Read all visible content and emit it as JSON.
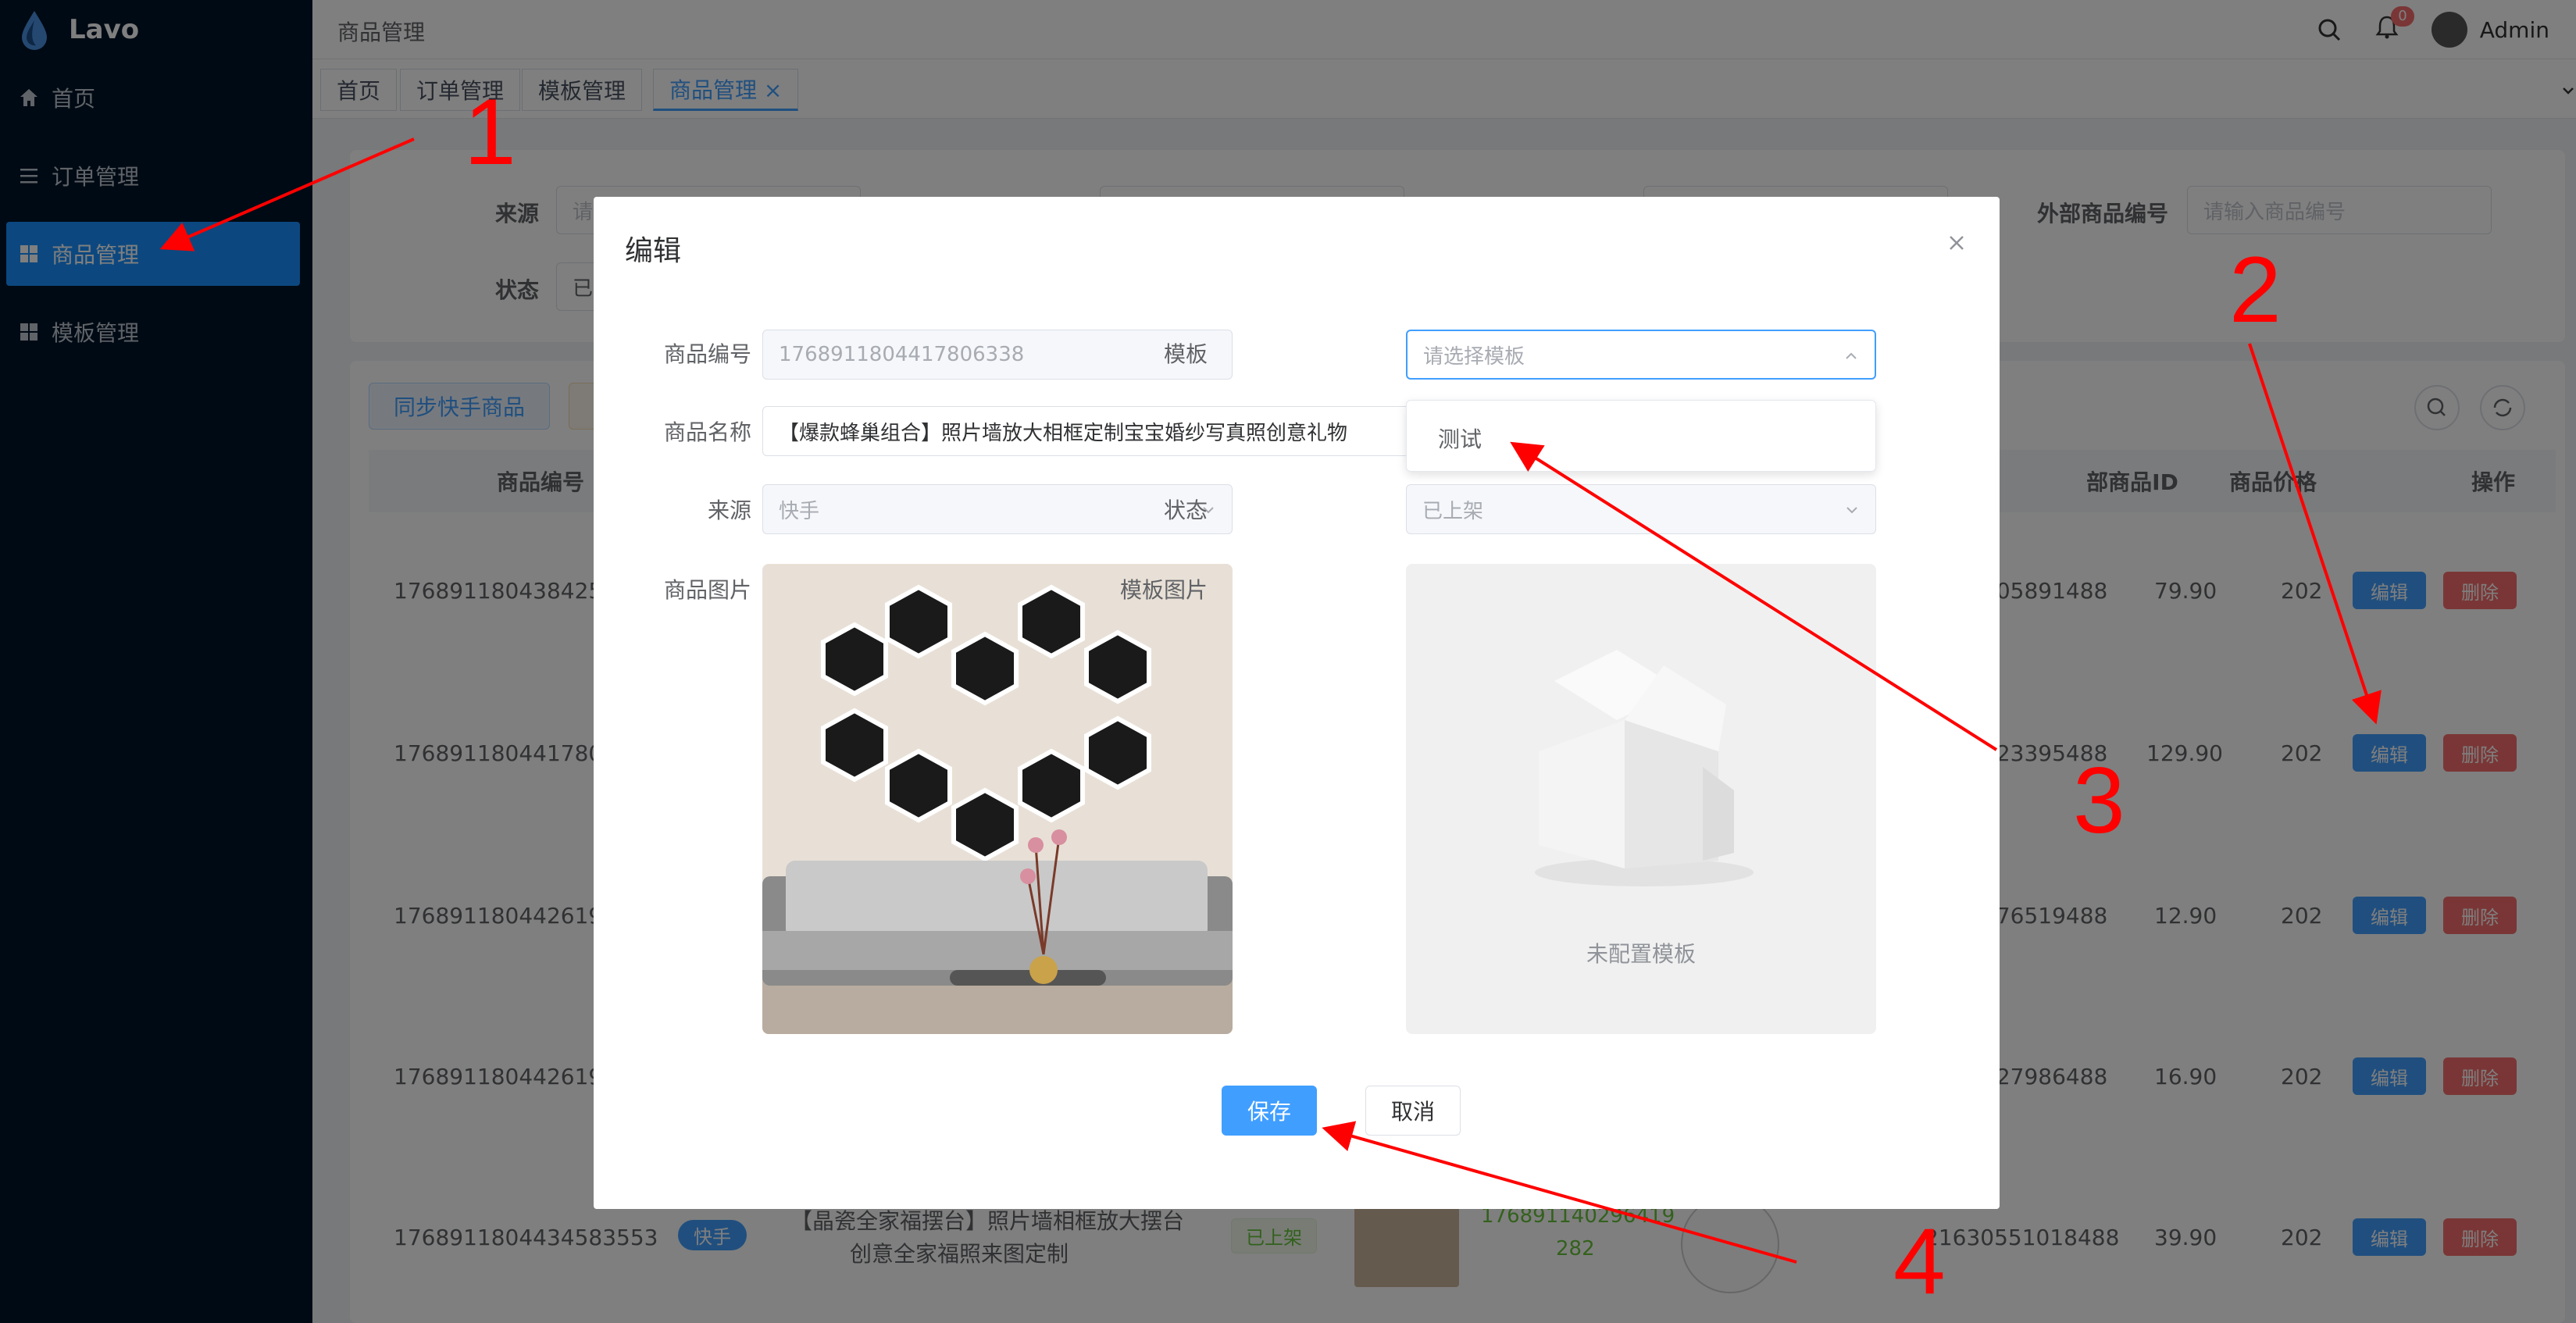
{
  "app": {
    "name": "Lavo"
  },
  "sidebar": {
    "items": [
      {
        "label": "首页",
        "icon": "home-icon"
      },
      {
        "label": "订单管理",
        "icon": "list-icon"
      },
      {
        "label": "商品管理",
        "icon": "grid-icon",
        "active": true
      },
      {
        "label": "模板管理",
        "icon": "grid-icon"
      }
    ]
  },
  "header": {
    "breadcrumb": "商品管理",
    "notification_count": "0",
    "user": "Admin"
  },
  "tabs": [
    {
      "label": "首页"
    },
    {
      "label": "订单管理"
    },
    {
      "label": "模板管理"
    },
    {
      "label": "商品管理 ×",
      "active": true
    }
  ],
  "filters": {
    "source_label": "来源",
    "source_value": "请",
    "status_label": "状态",
    "status_value": "已",
    "ext_label": "外部商品编号",
    "ext_placeholder": "请输入商品编号"
  },
  "toolbar": {
    "sync_label": "同步快手商品"
  },
  "table": {
    "headers": {
      "product_no": "商品编号",
      "ext_id": "部商品ID",
      "price": "商品价格",
      "actions": "操作"
    },
    "edit_label": "编辑",
    "delete_label": "删除",
    "rows": [
      {
        "product_no": "1768911804384251",
        "ext_id": "305891488",
        "price": "79.90",
        "date": "202"
      },
      {
        "product_no": "1768911804417806",
        "ext_id": "323395488",
        "price": "129.90",
        "date": "202"
      },
      {
        "product_no": "1768911804426194",
        "ext_id": "976519488",
        "price": "12.90",
        "date": "202"
      },
      {
        "product_no": "1768911804426194",
        "ext_id": "927986488",
        "price": "16.90",
        "date": "202"
      },
      {
        "product_no": "1768911804434583553",
        "source": "快手",
        "name_line1": "【晶瓷全家福摆台】照片墙相框放大摆台",
        "name_line2": "创意全家福照来图定制",
        "status": "已上架",
        "template_id_line1": "176891140296419",
        "template_id_line2": "282",
        "ext_id": "21630551018488",
        "price": "39.90",
        "date": "202"
      }
    ]
  },
  "dialog": {
    "title": "编辑",
    "fields": {
      "product_no_label": "商品编号",
      "product_no_value": "1768911804417806338",
      "template_label": "模板",
      "template_placeholder": "请选择模板",
      "name_label": "商品名称",
      "name_value": "【爆款蜂巢组合】照片墙放大相框定制宝宝婚纱写真照创意礼物",
      "source_label": "来源",
      "source_value": "快手",
      "status_label": "状态",
      "status_value": "已上架",
      "image_label": "商品图片",
      "template_image_label": "模板图片",
      "no_template_text": "未配置模板"
    },
    "dropdown_options": [
      "测试"
    ],
    "save_label": "保存",
    "cancel_label": "取消"
  },
  "annotations": {
    "n1": "1",
    "n2": "2",
    "n3": "3",
    "n4": "4",
    "color": "#ff0000"
  }
}
